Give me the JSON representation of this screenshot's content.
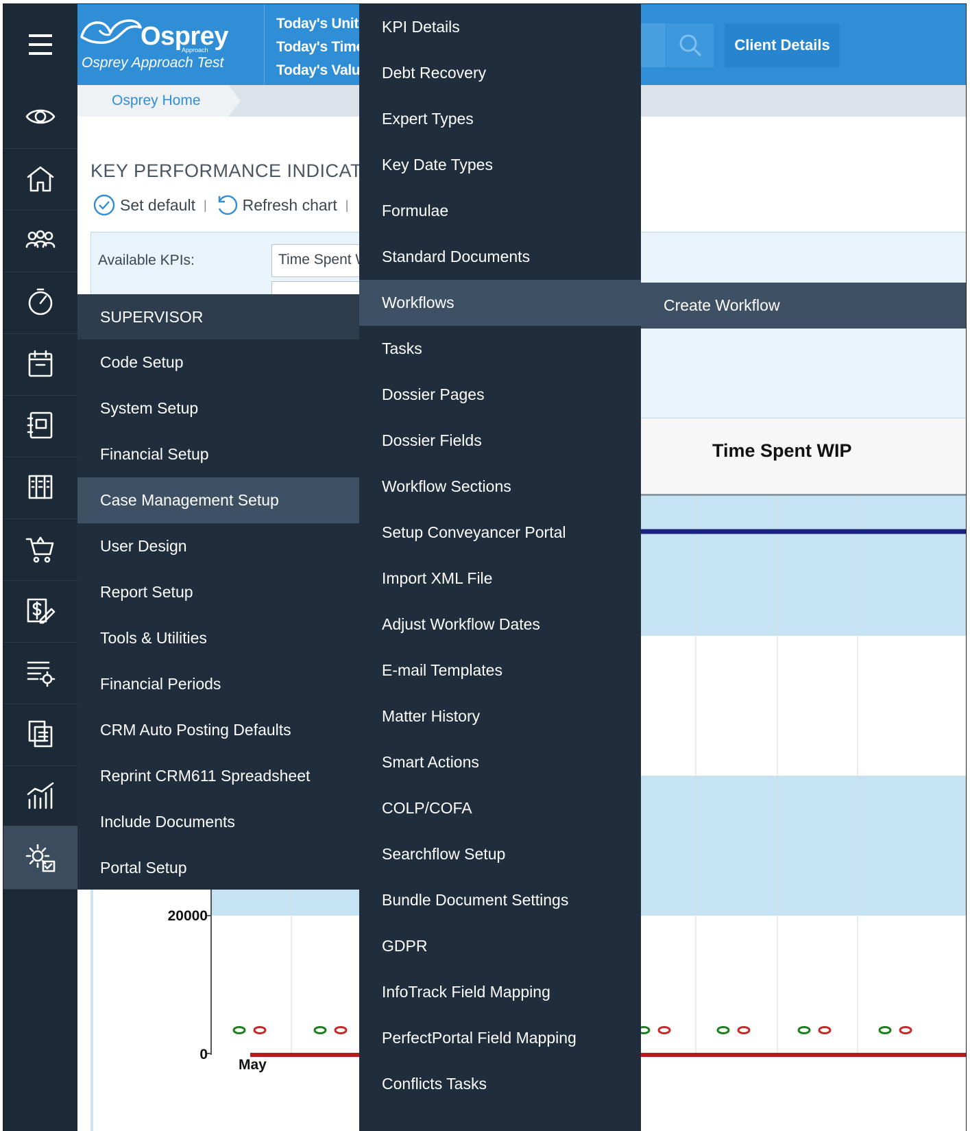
{
  "header": {
    "logo_title": "Osprey",
    "logo_mini": "Approach",
    "logo_subtitle": "Osprey Approach Test",
    "stats": [
      "Today's Units:",
      "Today's Time:",
      "Today's Value"
    ],
    "client_details_label": "Client Details"
  },
  "breadcrumb": {
    "home": "Osprey Home"
  },
  "page": {
    "title": "KEY PERFORMANCE INDICATOR",
    "toolbar": {
      "set_default": "Set default",
      "refresh_chart": "Refresh chart",
      "separator": "|"
    },
    "available_kpis_label": "Available KPIs:",
    "available_kpis_value": "Time Spent W"
  },
  "rail": {
    "icons": [
      "menu-icon",
      "eye-icon",
      "home-icon",
      "people-icon",
      "speedometer-icon",
      "calendar-icon",
      "ledger-icon",
      "building-icon",
      "cart-icon",
      "billing-icon",
      "list-settings-icon",
      "documents-icon",
      "chart-icon",
      "supervisor-icon"
    ]
  },
  "menu_supervisor": {
    "heading": "SUPERVISOR",
    "items": [
      "Code Setup",
      "System Setup",
      "Financial Setup",
      "Case Management Setup",
      "User Design",
      "Report Setup",
      "Tools & Utilities",
      "Financial Periods",
      "CRM Auto Posting Defaults",
      "Reprint CRM611 Spreadsheet",
      "Include Documents",
      "Portal Setup"
    ],
    "active_index": 3
  },
  "menu_case_management": {
    "items": [
      "KPI Details",
      "Debt Recovery",
      "Expert Types",
      "Key Date Types",
      "Formulae",
      "Standard Documents",
      "Workflows",
      "Tasks",
      "Dossier Pages",
      "Dossier Fields",
      "Workflow Sections",
      "Setup Conveyancer Portal",
      "Import XML File",
      "Adjust Workflow Dates",
      "E-mail Templates",
      "Matter History",
      "Smart Actions",
      "COLP/COFA",
      "Searchflow Setup",
      "Bundle Document Settings",
      "GDPR",
      "InfoTrack Field Mapping",
      "PerfectPortal Field Mapping",
      "Conflicts Tasks"
    ],
    "active_index": 6
  },
  "menu_workflows": {
    "items": [
      "Create Workflow"
    ]
  },
  "chart_data": {
    "type": "line",
    "title": "Time Spent WIP",
    "y_tick_labels": [
      "20000",
      "0"
    ],
    "x_tick_labels": [
      "May"
    ],
    "colors": {
      "band": "#c6e3f4",
      "series_dark": "#1a237e",
      "series_red": "#b71c1c",
      "marker_green": "#1b7f1b",
      "marker_red": "#c62828"
    }
  }
}
